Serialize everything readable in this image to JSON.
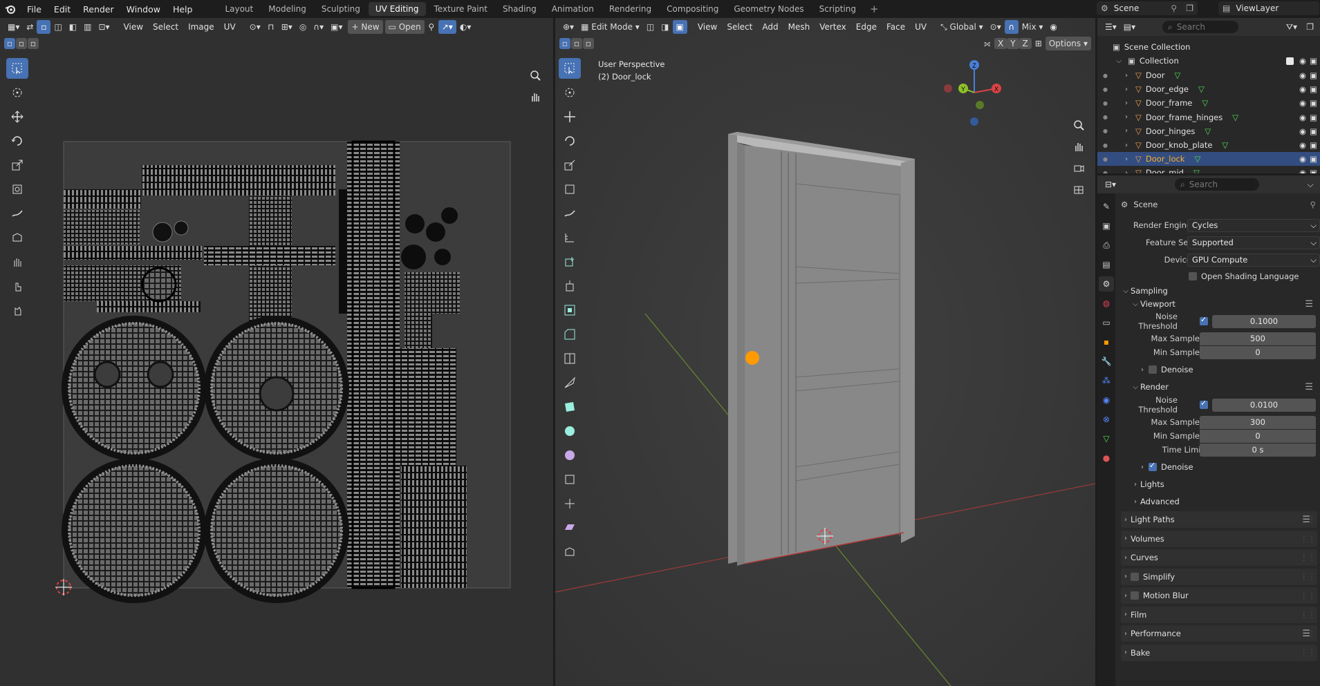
{
  "topbar": {
    "menus": [
      "File",
      "Edit",
      "Render",
      "Window",
      "Help"
    ],
    "workspaces": [
      "Layout",
      "Modeling",
      "Sculpting",
      "UV Editing",
      "Texture Paint",
      "Shading",
      "Animation",
      "Rendering",
      "Compositing",
      "Geometry Nodes",
      "Scripting"
    ],
    "active_workspace": "UV Editing",
    "scene": "Scene",
    "view_layer": "ViewLayer"
  },
  "uv_editor": {
    "menus": [
      "View",
      "Select",
      "Image",
      "UV"
    ],
    "new_label": "New",
    "open_label": "Open"
  },
  "viewport": {
    "mode": "Edit Mode",
    "menus": [
      "View",
      "Select",
      "Add",
      "Mesh",
      "Vertex",
      "Edge",
      "Face",
      "UV"
    ],
    "orientation": "Global",
    "shading_mix": "Mix",
    "options_label": "Options",
    "overlay_title": "User Perspective",
    "overlay_object": "(2) Door_lock",
    "axes": {
      "x": "X",
      "y": "Y",
      "z": "Z"
    }
  },
  "outliner": {
    "search_placeholder": "Search",
    "scene_collection": "Scene Collection",
    "collection": "Collection",
    "objects": [
      "Door",
      "Door_edge",
      "Door_frame",
      "Door_frame_hinges",
      "Door_hinges",
      "Door_knob_plate",
      "Door_lock",
      "Door_mid"
    ],
    "selected": "Door_lock"
  },
  "properties": {
    "search_placeholder": "Search",
    "context": "Scene",
    "render_engine_label": "Render Engine",
    "render_engine": "Cycles",
    "feature_set_label": "Feature Set",
    "feature_set": "Supported",
    "device_label": "Device",
    "device": "GPU Compute",
    "osl_label": "Open Shading Language",
    "sampling": "Sampling",
    "viewport": {
      "title": "Viewport",
      "noise_threshold_label": "Noise Threshold",
      "noise_threshold": "0.1000",
      "max_samples_label": "Max Samples",
      "max_samples": "500",
      "min_samples_label": "Min Samples",
      "min_samples": "0",
      "denoise_label": "Denoise"
    },
    "render": {
      "title": "Render",
      "noise_threshold_label": "Noise Threshold",
      "noise_threshold": "0.0100",
      "max_samples_label": "Max Samples",
      "max_samples": "300",
      "min_samples_label": "Min Samples",
      "min_samples": "0",
      "time_limit_label": "Time Limit",
      "time_limit": "0 s",
      "denoise_label": "Denoise"
    },
    "lights": "Lights",
    "advanced": "Advanced",
    "panels": [
      "Light Paths",
      "Volumes",
      "Curves",
      "Simplify",
      "Motion Blur",
      "Film",
      "Performance",
      "Bake"
    ]
  }
}
